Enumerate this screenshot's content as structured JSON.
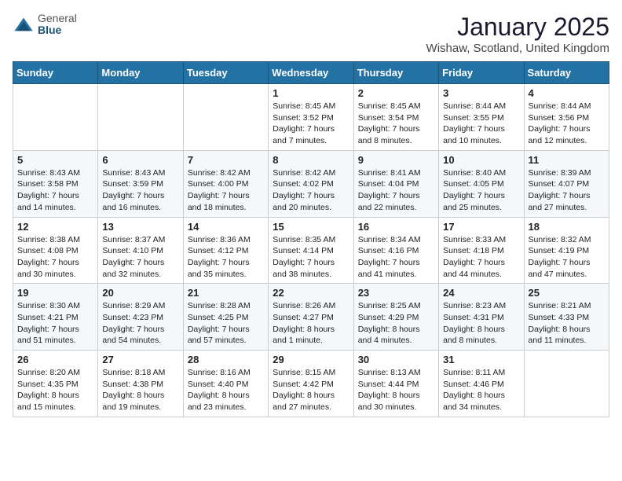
{
  "header": {
    "logo_general": "General",
    "logo_blue": "Blue",
    "title": "January 2025",
    "subtitle": "Wishaw, Scotland, United Kingdom"
  },
  "days_of_week": [
    "Sunday",
    "Monday",
    "Tuesday",
    "Wednesday",
    "Thursday",
    "Friday",
    "Saturday"
  ],
  "weeks": [
    [
      {
        "day": "",
        "info": ""
      },
      {
        "day": "",
        "info": ""
      },
      {
        "day": "",
        "info": ""
      },
      {
        "day": "1",
        "info": "Sunrise: 8:45 AM\nSunset: 3:52 PM\nDaylight: 7 hours\nand 7 minutes."
      },
      {
        "day": "2",
        "info": "Sunrise: 8:45 AM\nSunset: 3:54 PM\nDaylight: 7 hours\nand 8 minutes."
      },
      {
        "day": "3",
        "info": "Sunrise: 8:44 AM\nSunset: 3:55 PM\nDaylight: 7 hours\nand 10 minutes."
      },
      {
        "day": "4",
        "info": "Sunrise: 8:44 AM\nSunset: 3:56 PM\nDaylight: 7 hours\nand 12 minutes."
      }
    ],
    [
      {
        "day": "5",
        "info": "Sunrise: 8:43 AM\nSunset: 3:58 PM\nDaylight: 7 hours\nand 14 minutes."
      },
      {
        "day": "6",
        "info": "Sunrise: 8:43 AM\nSunset: 3:59 PM\nDaylight: 7 hours\nand 16 minutes."
      },
      {
        "day": "7",
        "info": "Sunrise: 8:42 AM\nSunset: 4:00 PM\nDaylight: 7 hours\nand 18 minutes."
      },
      {
        "day": "8",
        "info": "Sunrise: 8:42 AM\nSunset: 4:02 PM\nDaylight: 7 hours\nand 20 minutes."
      },
      {
        "day": "9",
        "info": "Sunrise: 8:41 AM\nSunset: 4:04 PM\nDaylight: 7 hours\nand 22 minutes."
      },
      {
        "day": "10",
        "info": "Sunrise: 8:40 AM\nSunset: 4:05 PM\nDaylight: 7 hours\nand 25 minutes."
      },
      {
        "day": "11",
        "info": "Sunrise: 8:39 AM\nSunset: 4:07 PM\nDaylight: 7 hours\nand 27 minutes."
      }
    ],
    [
      {
        "day": "12",
        "info": "Sunrise: 8:38 AM\nSunset: 4:08 PM\nDaylight: 7 hours\nand 30 minutes."
      },
      {
        "day": "13",
        "info": "Sunrise: 8:37 AM\nSunset: 4:10 PM\nDaylight: 7 hours\nand 32 minutes."
      },
      {
        "day": "14",
        "info": "Sunrise: 8:36 AM\nSunset: 4:12 PM\nDaylight: 7 hours\nand 35 minutes."
      },
      {
        "day": "15",
        "info": "Sunrise: 8:35 AM\nSunset: 4:14 PM\nDaylight: 7 hours\nand 38 minutes."
      },
      {
        "day": "16",
        "info": "Sunrise: 8:34 AM\nSunset: 4:16 PM\nDaylight: 7 hours\nand 41 minutes."
      },
      {
        "day": "17",
        "info": "Sunrise: 8:33 AM\nSunset: 4:18 PM\nDaylight: 7 hours\nand 44 minutes."
      },
      {
        "day": "18",
        "info": "Sunrise: 8:32 AM\nSunset: 4:19 PM\nDaylight: 7 hours\nand 47 minutes."
      }
    ],
    [
      {
        "day": "19",
        "info": "Sunrise: 8:30 AM\nSunset: 4:21 PM\nDaylight: 7 hours\nand 51 minutes."
      },
      {
        "day": "20",
        "info": "Sunrise: 8:29 AM\nSunset: 4:23 PM\nDaylight: 7 hours\nand 54 minutes."
      },
      {
        "day": "21",
        "info": "Sunrise: 8:28 AM\nSunset: 4:25 PM\nDaylight: 7 hours\nand 57 minutes."
      },
      {
        "day": "22",
        "info": "Sunrise: 8:26 AM\nSunset: 4:27 PM\nDaylight: 8 hours\nand 1 minute."
      },
      {
        "day": "23",
        "info": "Sunrise: 8:25 AM\nSunset: 4:29 PM\nDaylight: 8 hours\nand 4 minutes."
      },
      {
        "day": "24",
        "info": "Sunrise: 8:23 AM\nSunset: 4:31 PM\nDaylight: 8 hours\nand 8 minutes."
      },
      {
        "day": "25",
        "info": "Sunrise: 8:21 AM\nSunset: 4:33 PM\nDaylight: 8 hours\nand 11 minutes."
      }
    ],
    [
      {
        "day": "26",
        "info": "Sunrise: 8:20 AM\nSunset: 4:35 PM\nDaylight: 8 hours\nand 15 minutes."
      },
      {
        "day": "27",
        "info": "Sunrise: 8:18 AM\nSunset: 4:38 PM\nDaylight: 8 hours\nand 19 minutes."
      },
      {
        "day": "28",
        "info": "Sunrise: 8:16 AM\nSunset: 4:40 PM\nDaylight: 8 hours\nand 23 minutes."
      },
      {
        "day": "29",
        "info": "Sunrise: 8:15 AM\nSunset: 4:42 PM\nDaylight: 8 hours\nand 27 minutes."
      },
      {
        "day": "30",
        "info": "Sunrise: 8:13 AM\nSunset: 4:44 PM\nDaylight: 8 hours\nand 30 minutes."
      },
      {
        "day": "31",
        "info": "Sunrise: 8:11 AM\nSunset: 4:46 PM\nDaylight: 8 hours\nand 34 minutes."
      },
      {
        "day": "",
        "info": ""
      }
    ]
  ]
}
